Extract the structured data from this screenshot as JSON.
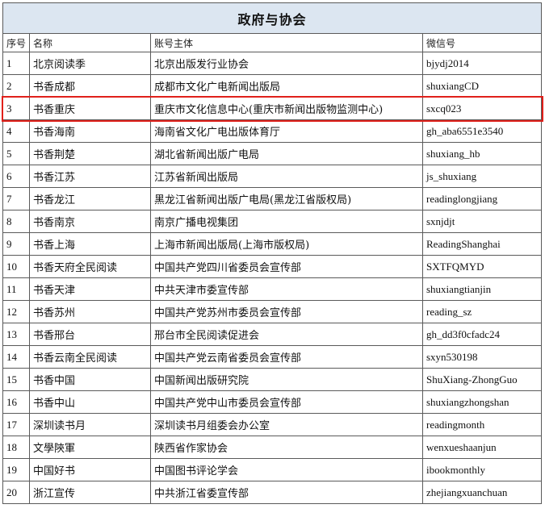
{
  "title": "政府与协会",
  "columns": [
    "序号",
    "名称",
    "账号主体",
    "微信号"
  ],
  "highlight_color": "#e0201a",
  "header_bg": "#dce6f1",
  "rows": [
    {
      "no": "1",
      "name": "北京阅读季",
      "entity": "北京出版发行业协会",
      "wechat": "bjydj2014"
    },
    {
      "no": "2",
      "name": "书香成都",
      "entity": "成都市文化广电新闻出版局",
      "wechat": "shuxiangCD"
    },
    {
      "no": "3",
      "name": "书香重庆",
      "entity": "重庆市文化信息中心(重庆市新闻出版物监测中心)",
      "wechat": "sxcq023",
      "highlighted": true
    },
    {
      "no": "4",
      "name": "书香海南",
      "entity": "海南省文化广电出版体育厅",
      "wechat": "gh_aba6551e3540"
    },
    {
      "no": "5",
      "name": "书香荆楚",
      "entity": "湖北省新闻出版广电局",
      "wechat": "shuxiang_hb"
    },
    {
      "no": "6",
      "name": "书香江苏",
      "entity": "江苏省新闻出版局",
      "wechat": "js_shuxiang"
    },
    {
      "no": "7",
      "name": "书香龙江",
      "entity": "黑龙江省新闻出版广电局(黑龙江省版权局)",
      "wechat": "readinglongjiang"
    },
    {
      "no": "8",
      "name": "书香南京",
      "entity": "南京广播电视集团",
      "wechat": "sxnjdjt"
    },
    {
      "no": "9",
      "name": "书香上海",
      "entity": "上海市新闻出版局(上海市版权局)",
      "wechat": "ReadingShanghai"
    },
    {
      "no": "10",
      "name": "书香天府全民阅读",
      "entity": "中国共产党四川省委员会宣传部",
      "wechat": "SXTFQMYD"
    },
    {
      "no": "11",
      "name": "书香天津",
      "entity": "中共天津市委宣传部",
      "wechat": "shuxiangtianjin"
    },
    {
      "no": "12",
      "name": "书香苏州",
      "entity": "中国共产党苏州市委员会宣传部",
      "wechat": "reading_sz"
    },
    {
      "no": "13",
      "name": "书香邢台",
      "entity": "邢台市全民阅读促进会",
      "wechat": "gh_dd3f0cfadc24"
    },
    {
      "no": "14",
      "name": "书香云南全民阅读",
      "entity": "中国共产党云南省委员会宣传部",
      "wechat": "sxyn530198"
    },
    {
      "no": "15",
      "name": "书香中国",
      "entity": "中国新闻出版研究院",
      "wechat": "ShuXiang-ZhongGuo"
    },
    {
      "no": "16",
      "name": "书香中山",
      "entity": "中国共产党中山市委员会宣传部",
      "wechat": "shuxiangzhongshan"
    },
    {
      "no": "17",
      "name": "深圳读书月",
      "entity": "深圳读书月组委会办公室",
      "wechat": "readingmonth"
    },
    {
      "no": "18",
      "name": "文學陝軍",
      "entity": "陕西省作家协会",
      "wechat": "wenxueshaanjun"
    },
    {
      "no": "19",
      "name": "中国好书",
      "entity": "中国图书评论学会",
      "wechat": "ibookmonthly"
    },
    {
      "no": "20",
      "name": "浙江宣传",
      "entity": "中共浙江省委宣传部",
      "wechat": "zhejiangxuanchuan"
    }
  ]
}
